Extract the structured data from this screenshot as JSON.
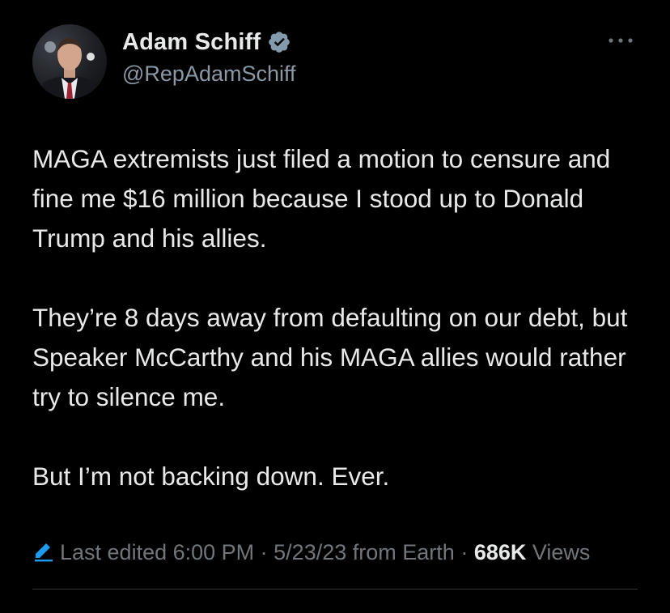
{
  "author": {
    "display_name": "Adam Schiff",
    "handle": "@RepAdamSchiff",
    "verified": true
  },
  "tweet": {
    "paragraphs": [
      "MAGA extremists just filed a motion to censure and fine me $16 million because I stood up to Donald Trump and his allies.",
      "They’re 8 days away from defaulting on our debt, but Speaker McCarthy and his MAGA allies would rather try to silence me.",
      "But I’m not backing down. Ever."
    ]
  },
  "meta": {
    "edited_label": "Last edited 6:00 PM",
    "separator": " · ",
    "date": "5/23/23",
    "source": "from Earth",
    "views_count": "686K",
    "views_label": "Views"
  },
  "icons": {
    "verified": "verified-badge-icon",
    "more": "more-options-icon",
    "edit": "edit-pencil-icon"
  },
  "colors": {
    "background": "#000000",
    "text_primary": "#e7e9ea",
    "text_secondary": "#71767b",
    "accent": "#1d9bf0",
    "verified_badge": "#829aab"
  }
}
